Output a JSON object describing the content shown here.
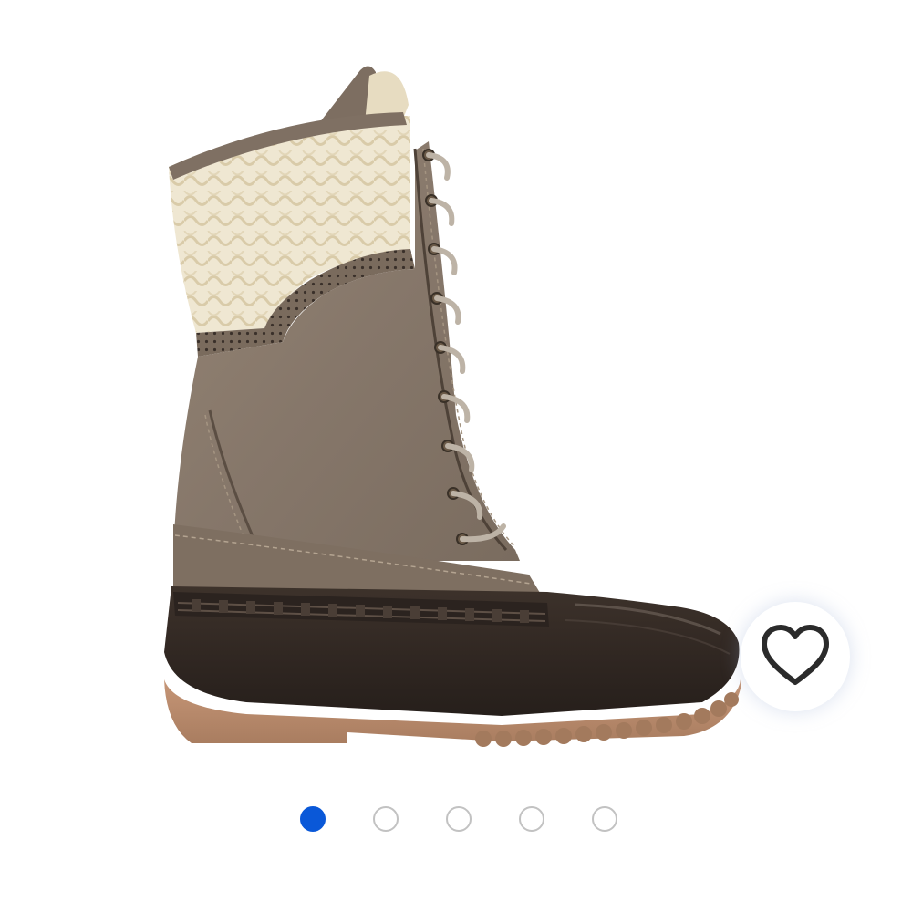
{
  "product_image": {
    "alt": "",
    "icon": "duck-boot-image"
  },
  "favorite": {
    "icon": "heart-icon",
    "favorited": false
  },
  "carousel": {
    "total": 5,
    "active_index": 0
  },
  "colors": {
    "active_dot": "#0a58d8",
    "inactive_dot_border": "#c2c2c2",
    "heart_stroke": "#2b2b2b",
    "boot_upper": "#8a7b6c",
    "boot_rubber": "#342a24",
    "boot_sole": "#b88a6a",
    "boot_knit": "#efe6cf"
  }
}
